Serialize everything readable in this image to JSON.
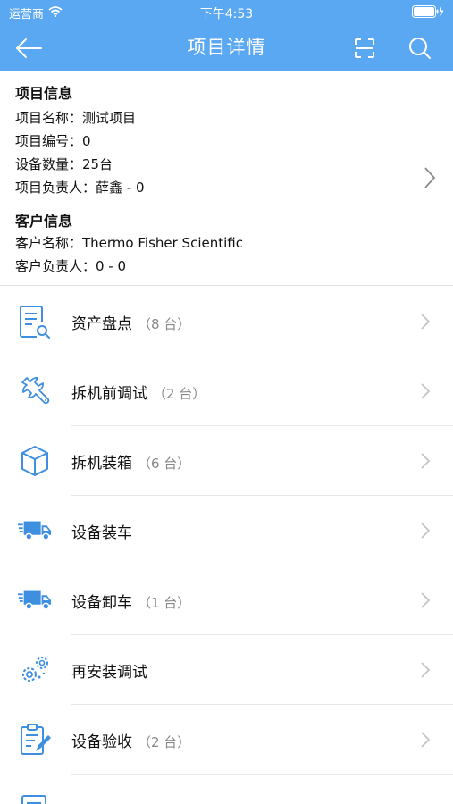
{
  "status_bar": {
    "carrier": "运营商",
    "time": "下午4:53"
  },
  "nav": {
    "title": "项目详情",
    "back_icon": "arrow-left-icon",
    "scan_icon": "scan-icon",
    "search_icon": "search-icon"
  },
  "project_info": {
    "section_title": "项目信息",
    "name_label": "项目名称：测试项目",
    "number_label": "项目编号：0",
    "device_count_label": "设备数量：25台",
    "manager_label": "项目负责人：薛鑫 - 0"
  },
  "customer_info": {
    "section_title": "客户信息",
    "name_label": "客户名称：Thermo Fisher Scientific",
    "manager_label": "客户负责人：0 - 0"
  },
  "menu": {
    "items": [
      {
        "label": "资产盘点",
        "count": "（8 台）",
        "icon": "inventory-doc-icon"
      },
      {
        "label": "拆机前调试",
        "count": "（2 台）",
        "icon": "wrench-icon"
      },
      {
        "label": "拆机装箱",
        "count": "（6 台）",
        "icon": "box-icon"
      },
      {
        "label": "设备装车",
        "count": "",
        "icon": "truck-load-icon"
      },
      {
        "label": "设备卸车",
        "count": "（1 台）",
        "icon": "truck-unload-icon"
      },
      {
        "label": "再安装调试",
        "count": "",
        "icon": "gears-icon"
      },
      {
        "label": "设备验收",
        "count": "（2 台）",
        "icon": "clipboard-check-icon"
      }
    ]
  },
  "colors": {
    "header": "#5aa7f2",
    "icon_blue": "#3f8fe0",
    "chevron": "#c4c4c4"
  }
}
